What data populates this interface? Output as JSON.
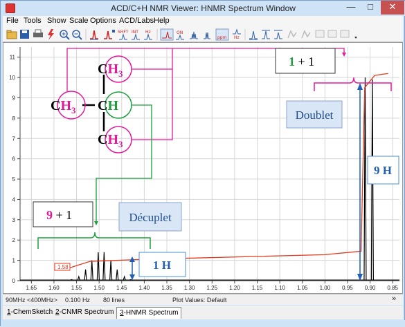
{
  "window": {
    "title": "ACD/C+H NMR Viewer: HNMR Spectrum Window"
  },
  "menu": [
    "File",
    "Tools",
    "Show",
    "Scale",
    "Options",
    "ACD/Labs",
    "Help"
  ],
  "toolbar_icons": [
    "open-icon",
    "save-icon",
    "print-icon",
    "lightning-icon",
    "zoom-in-icon",
    "zoom-out-icon",
    "peak-icon",
    "peak-label-icon",
    "shift-icon",
    "int-icon",
    "hz-icon",
    "integrate-icon",
    "on-off-icon",
    "multiplet-icon",
    "multiplet-table-icon",
    "ppm-icon",
    "hz-scale-icon",
    "cursor-icon",
    "expand-icon",
    "compress-icon",
    "export-icon",
    "copy-icon",
    "more-icon"
  ],
  "toolbar_labels": {
    "shift": "SHFT",
    "int": "INT",
    "hz": "Hz",
    "on_off": "ON",
    "ppm": "ppm",
    "hz2": "Hz"
  },
  "molecule": {
    "c": "C",
    "h": "H",
    "ch": "CH",
    "sub3": "3"
  },
  "annotations": {
    "one": "1",
    "nine": "9",
    "plus_one": " + 1",
    "doublet": "Doublet",
    "decuplet": "Décuplet",
    "nine_h": "9 H",
    "one_h": "1 H",
    "integral_value": "1.58"
  },
  "chart_data": {
    "type": "line",
    "xlabel": "",
    "ylabel": "",
    "x_ticks": [
      "1.65",
      "1.60",
      "1.55",
      "1.50",
      "1.45",
      "1.40",
      "1.35",
      "1.30",
      "1.25",
      "1.20",
      "1.15",
      "1.10",
      "1.05",
      "1.00",
      "0.95",
      "0.90",
      "0.85"
    ],
    "y_ticks": [
      "0",
      "1",
      "2",
      "3",
      "4",
      "5",
      "6",
      "7",
      "8",
      "9",
      "10",
      "11"
    ],
    "xlim": [
      1.675,
      0.835
    ],
    "ylim": [
      0,
      11.5
    ],
    "grid": true,
    "decuplet_peaks": {
      "x": [
        1.561,
        1.545,
        1.53,
        1.516,
        1.502,
        1.489,
        1.474,
        1.46,
        1.444,
        1.43
      ],
      "y": [
        0.05,
        0.2,
        0.55,
        1.0,
        1.4,
        1.4,
        1.0,
        0.55,
        0.2,
        0.05
      ]
    },
    "doublet_peaks": {
      "x": [
        0.911,
        0.895
      ],
      "y": [
        10.0,
        9.9
      ]
    },
    "integral_curve": {
      "x": [
        1.57,
        1.52,
        1.4,
        1.0,
        0.92,
        0.912,
        0.89,
        0.86
      ],
      "y": [
        0.6,
        0.95,
        1.05,
        1.28,
        1.45,
        9.5,
        10.1,
        10.2
      ]
    }
  },
  "status": {
    "spectrometer": "90MHz <400MHz>",
    "resolution": "0.100 Hz",
    "lines": "80 lines",
    "plot_values": "Plot Values: Default",
    "chevron": "»"
  },
  "tabs": [
    {
      "num": "1",
      "label": "-ChemSketch"
    },
    {
      "num": "2",
      "label": "-CNMR Spectrum"
    },
    {
      "num": "3",
      "label": "-HNMR Spectrum"
    }
  ],
  "colors": {
    "magenta": "#e3199a",
    "green": "#1a9f3c",
    "blue": "#1f5fb4",
    "red": "#e03a1e",
    "axis": "#444444",
    "grid": "#d6d6d6"
  }
}
